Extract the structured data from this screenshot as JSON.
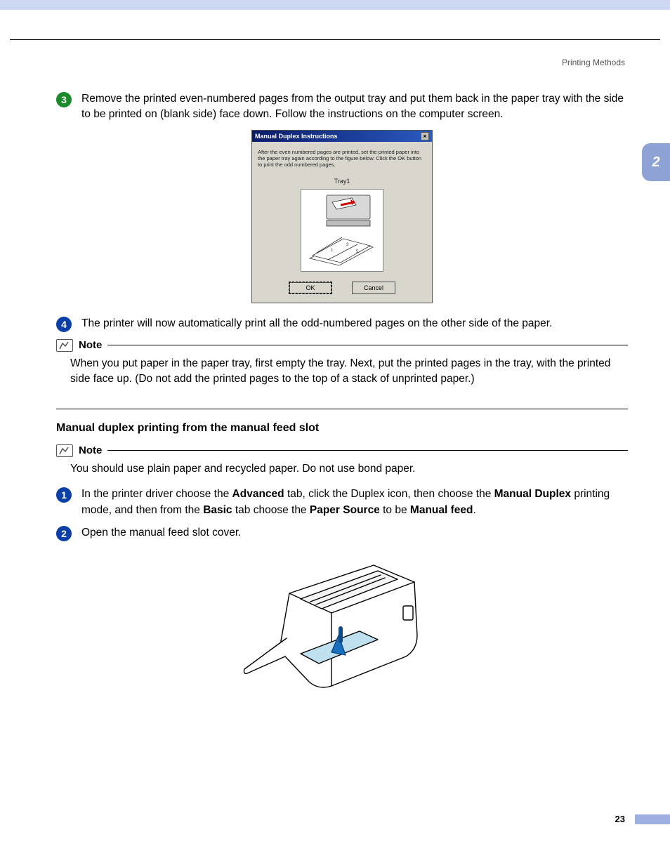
{
  "header": {
    "section": "Printing Methods"
  },
  "side_tab": "2",
  "step3": {
    "num": "3",
    "text": "Remove the printed even-numbered pages from the output tray and put them back in the paper tray with the side to be printed on (blank side) face down. Follow the instructions on the computer screen."
  },
  "dialog": {
    "title": "Manual Duplex Instructions",
    "message": "After the even numbered pages are printed, set the printed paper into the paper tray again according to the figure below. Click the OK button to print the odd numbered pages.",
    "tray": "Tray1",
    "ok": "OK",
    "cancel": "Cancel"
  },
  "step4": {
    "num": "4",
    "text": "The printer will now automatically print all the odd-numbered pages on the other side of the paper."
  },
  "note1": {
    "label": "Note",
    "text": "When you put paper in the paper tray, first empty the tray. Next, put the printed pages in the tray, with the printed side face up. (Do not add the printed pages to the top of a stack of unprinted paper.)"
  },
  "section2": {
    "title": "Manual duplex printing from the manual feed slot"
  },
  "note2": {
    "label": "Note",
    "text": "You should use plain paper and recycled paper. Do not use bond paper."
  },
  "step1b": {
    "num": "1",
    "parts": {
      "p1": "In the printer driver choose the ",
      "b1": "Advanced",
      "p2": " tab, click the Duplex icon, then choose the ",
      "b2": "Manual Duplex",
      "p3": " printing mode, and then from the ",
      "b3": "Basic",
      "p4": " tab choose the ",
      "b4": "Paper Source",
      "p5": " to be ",
      "b5": "Manual feed",
      "p6": "."
    }
  },
  "step2b": {
    "num": "2",
    "text": "Open the manual feed slot cover."
  },
  "page_number": "23"
}
